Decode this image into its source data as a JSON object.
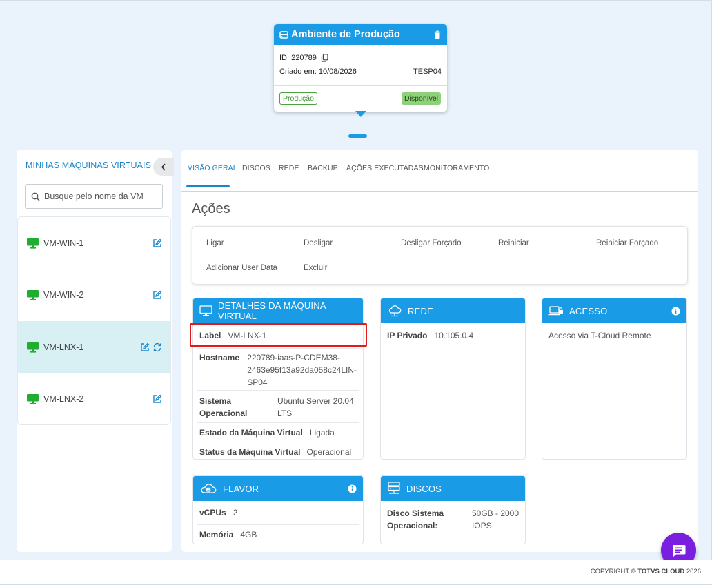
{
  "environment": {
    "title": "Ambiente de Produção",
    "id_label": "ID: 220789",
    "created_label": "Criado em: 10/08/2026",
    "code": "TESP04",
    "badge_type": "Produção",
    "badge_status": "Disponível"
  },
  "sidebar": {
    "title": "MINHAS MÁQUINAS VIRTUAIS",
    "search_placeholder": "Busque pelo nome da VM",
    "items": [
      {
        "name": "VM-WIN-1"
      },
      {
        "name": "VM-WIN-2"
      },
      {
        "name": "VM-LNX-1"
      },
      {
        "name": "VM-LNX-2"
      }
    ]
  },
  "tabs": [
    "VISÃO GERAL",
    "DISCOS",
    "REDE",
    "BACKUP",
    "AÇÕES EXECUTADAS",
    "MONITORAMENTO"
  ],
  "actions": {
    "title": "Ações",
    "items": [
      "Ligar",
      "Desligar",
      "Desligar Forçado",
      "Reiniciar",
      "Reiniciar Forçado",
      "Adicionar User Data",
      "Excluir"
    ]
  },
  "details": {
    "title": "DETALHES DA MÁQUINA VIRTUAL",
    "label_key": "Label",
    "label_val": "VM-LNX-1",
    "hostname_key": "Hostname",
    "hostname_val_1": "220789-iaas-P-CDEM38-",
    "hostname_val_2": "2463e95f13a92da058c24LIN-",
    "hostname_val_3": "SP04",
    "os_key_1": "Sistema",
    "os_key_2": "Operacional",
    "os_val_1": "Ubuntu Server 20.04",
    "os_val_2": "LTS",
    "state_key": "Estado da Máquina Virtual",
    "state_val": "Ligada",
    "status_key": "Status da Máquina Virtual",
    "status_val": "Operacional"
  },
  "network": {
    "title": "REDE",
    "ip_key": "IP Privado",
    "ip_val": "10.105.0.4"
  },
  "access": {
    "title": "ACESSO",
    "text": "Acesso via T-Cloud Remote"
  },
  "flavor": {
    "title": "FLAVOR",
    "vcpu_key": "vCPUs",
    "vcpu_val": "2",
    "mem_key": "Memória",
    "mem_val": "4GB"
  },
  "disks": {
    "title": "DISCOS",
    "key_1": "Disco Sistema",
    "key_2": "Operacional:",
    "val_1": "50GB - 2000",
    "val_2": "IOPS"
  },
  "footer": {
    "prefix": "COPYRIGHT © ",
    "brand": "TOTVS CLOUD",
    "year": " 2026"
  },
  "colors": {
    "primary": "#1a9be6",
    "link": "#1a86c9",
    "vm_icon": "#1fae2f",
    "chat": "#7a1fe0",
    "highlight": "#e01b1b"
  }
}
